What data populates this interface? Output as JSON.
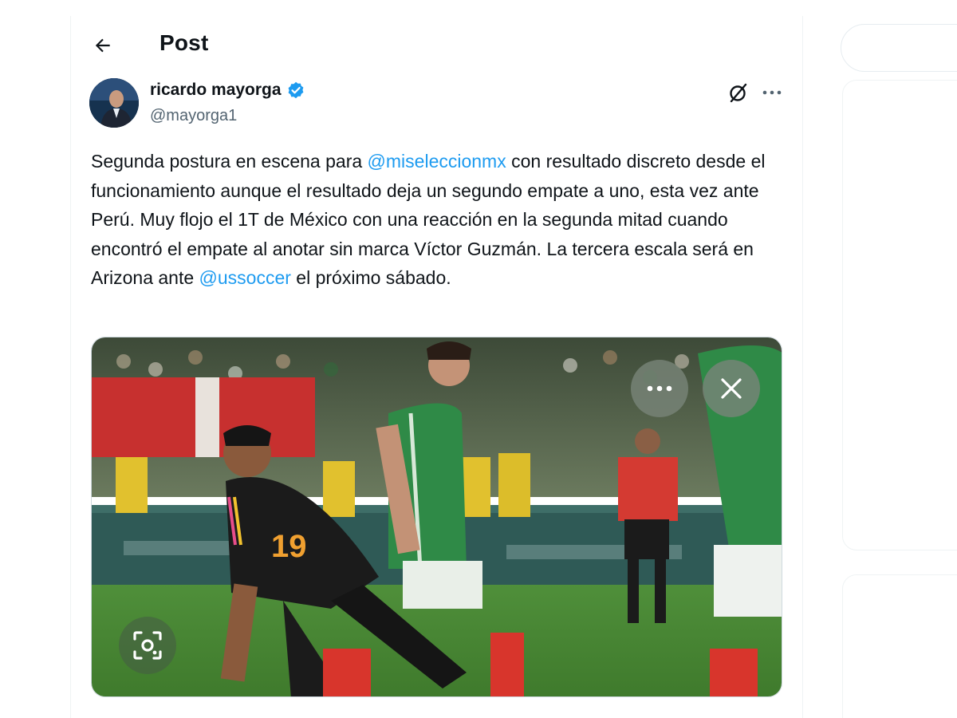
{
  "header": {
    "title": "Post"
  },
  "author": {
    "name": "ricardo mayorga",
    "handle": "@mayorga1"
  },
  "tweet": {
    "text_before_mention1": "Segunda postura en escena para ",
    "mention1": "@miseleccionmx",
    "text_after_mention1": " con resultado discreto desde el funcionamiento aunque el resultado deja un segundo empate a uno, esta vez ante Perú. Muy flojo el 1T de México con una reacción en la segunda mitad cuando encontró el empate al anotar sin marca Víctor Guzmán. La tercera escala será en Arizona ante ",
    "mention2": "@ussoccer",
    "text_after_mention2": " el próximo sábado."
  },
  "media": {
    "player_number": "19"
  },
  "colors": {
    "accent": "#1d9bf0",
    "verified": "#1d9bf0",
    "text": "#0f1419",
    "muted": "#536471"
  },
  "icons": {
    "back": "arrow-left-icon",
    "verified": "verified-badge-icon",
    "grok": "grok-icon",
    "more": "more-horizontal-icon",
    "media_more": "more-horizontal-icon",
    "media_close": "close-icon",
    "lens": "visual-search-icon"
  }
}
